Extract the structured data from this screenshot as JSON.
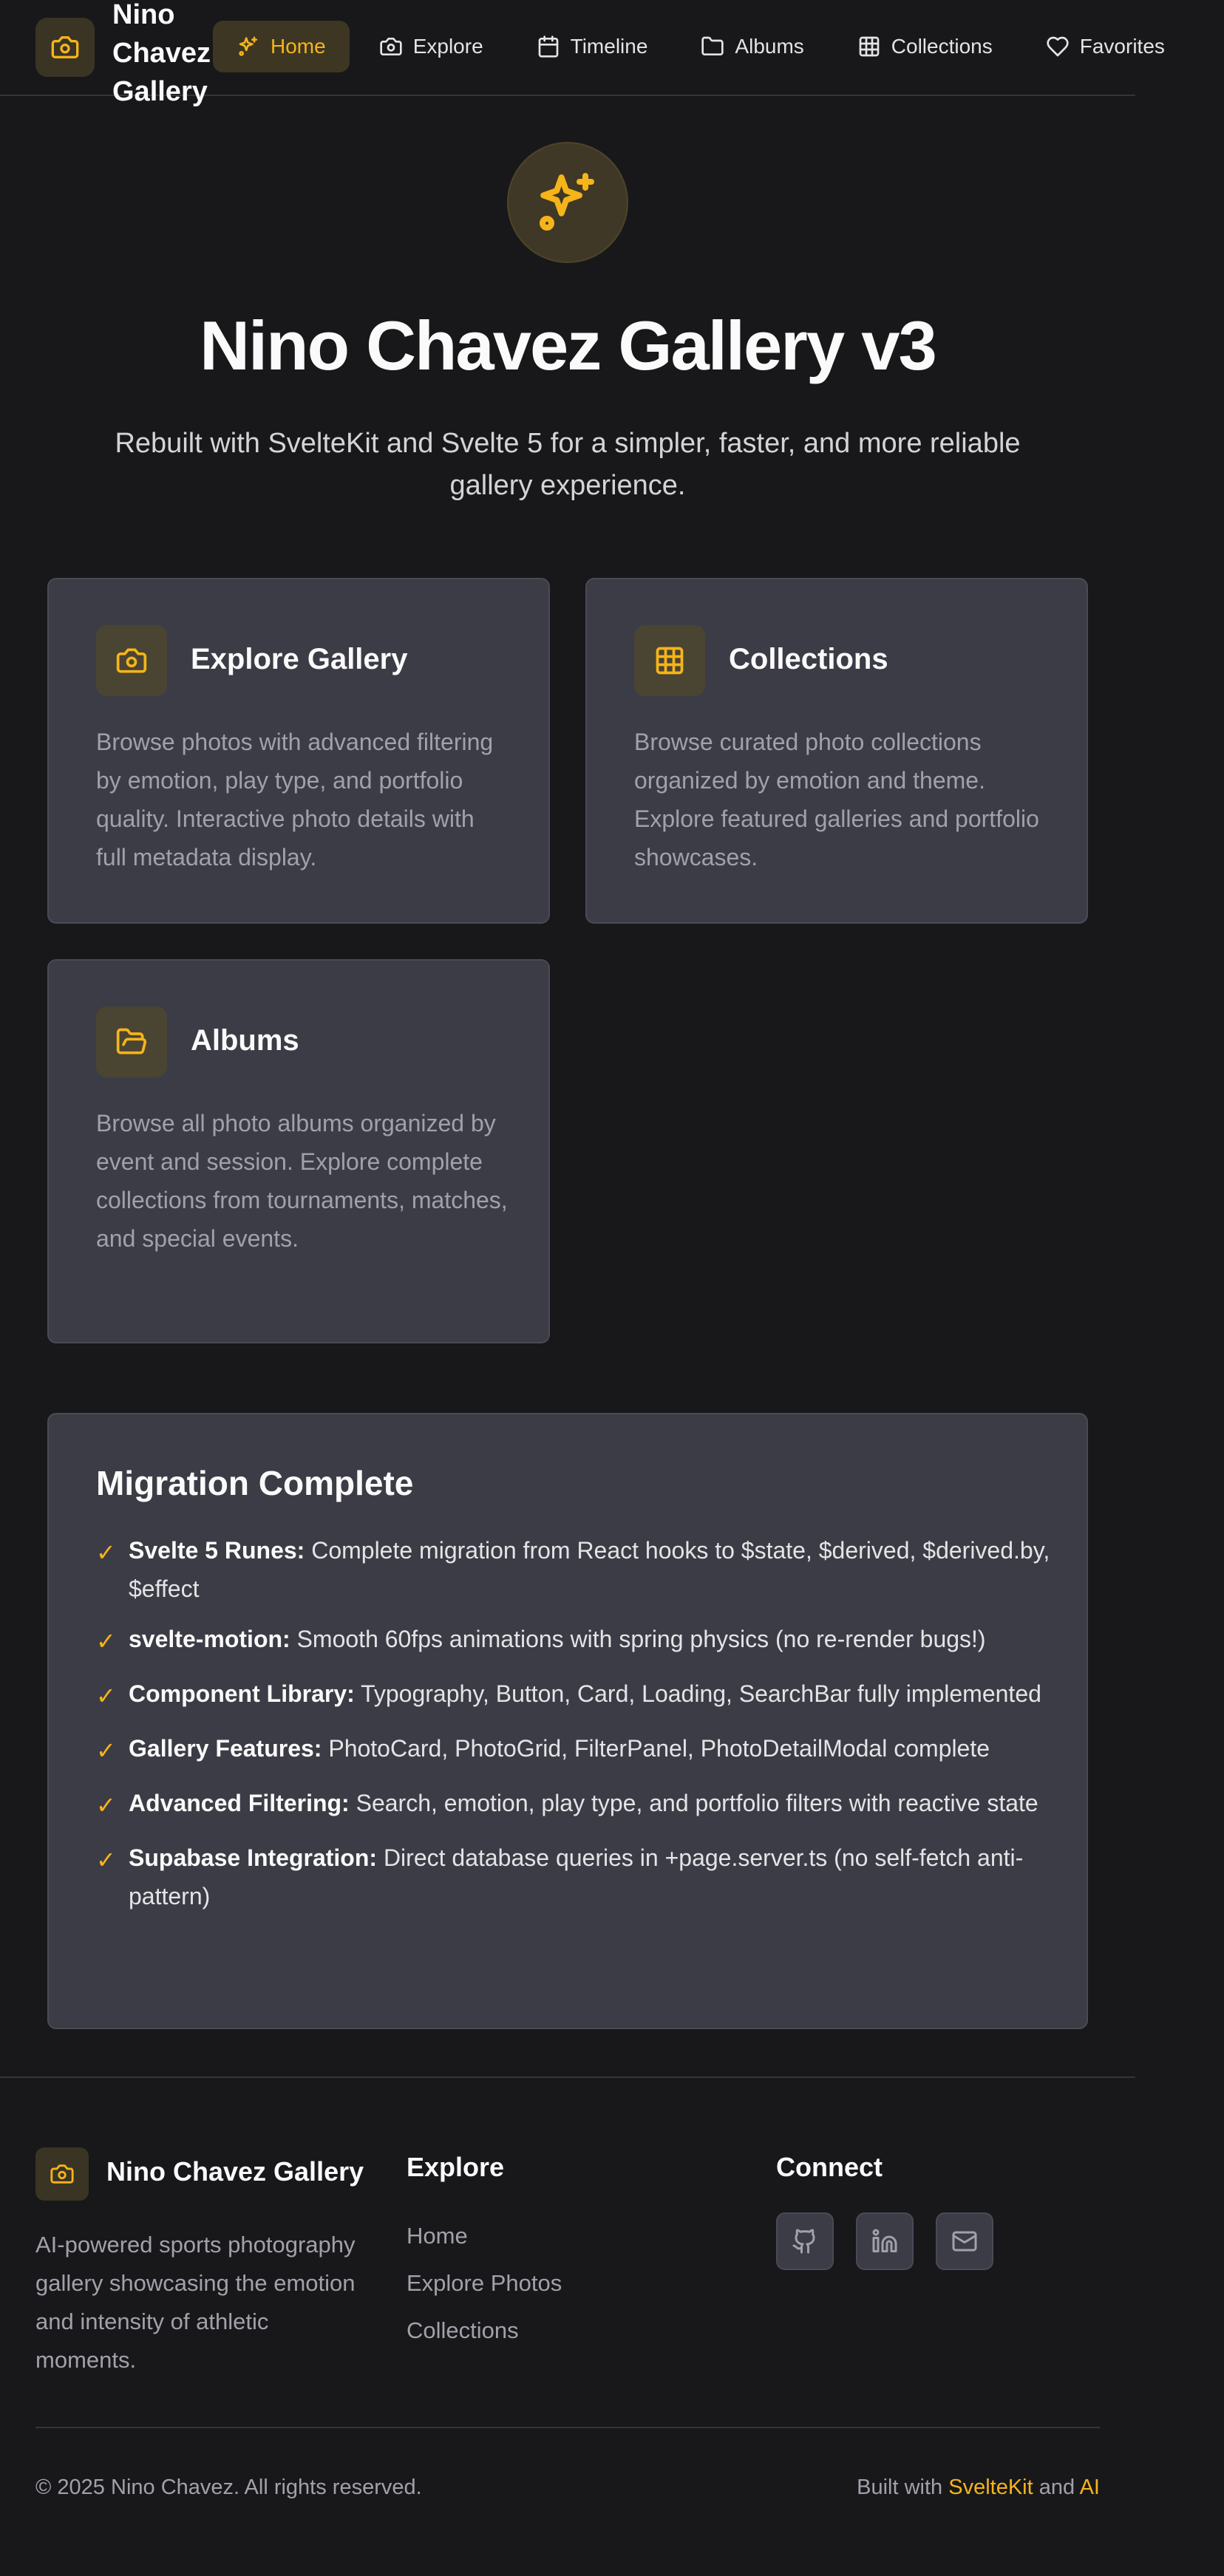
{
  "nav": {
    "brand": "Nino Chavez Gallery",
    "logo_icon": "camera-icon",
    "links": [
      {
        "label": "Home",
        "icon": "sparkles-icon",
        "active": true
      },
      {
        "label": "Explore",
        "icon": "camera-icon"
      },
      {
        "label": "Timeline",
        "icon": "calendar-icon"
      },
      {
        "label": "Albums",
        "icon": "folder-icon"
      },
      {
        "label": "Collections",
        "icon": "grid-icon"
      },
      {
        "label": "Favorites",
        "icon": "heart-icon"
      }
    ]
  },
  "hero": {
    "icon": "sparkles-icon",
    "title": "Nino Chavez Gallery v3",
    "subtitle": "Rebuilt with SvelteKit and Svelte 5 for a simpler, faster, and more reliable gallery experience."
  },
  "features": [
    {
      "title": "Explore Gallery",
      "icon": "camera-icon",
      "description": "Browse photos with advanced filtering by emotion, play type, and portfolio quality. Interactive photo details with full metadata display."
    },
    {
      "title": "Collections",
      "icon": "grid-icon",
      "description": "Browse curated photo collections organized by emotion and theme. Explore featured galleries and portfolio showcases."
    },
    {
      "title": "Albums",
      "icon": "folder-open-icon",
      "description": "Browse all photo albums organized by event and session. Explore complete collections from tournaments, matches, and special events."
    }
  ],
  "migration": {
    "title": "Migration Complete",
    "check_glyph": "✓",
    "items": [
      {
        "label": "Svelte 5 Runes:",
        "text": "Complete migration from React hooks to $state, $derived, $derived.by, $effect"
      },
      {
        "label": "svelte-motion:",
        "text": "Smooth 60fps animations with spring physics (no re-render bugs!)"
      },
      {
        "label": "Component Library:",
        "text": "Typography, Button, Card, Loading, SearchBar fully implemented"
      },
      {
        "label": "Gallery Features:",
        "text": "PhotoCard, PhotoGrid, FilterPanel, PhotoDetailModal complete"
      },
      {
        "label": "Advanced Filtering:",
        "text": "Search, emotion, play type, and portfolio filters with reactive state"
      },
      {
        "label": "Supabase Integration:",
        "text": "Direct database queries in +page.server.ts (no self-fetch anti-pattern)"
      }
    ]
  },
  "footer": {
    "brand": "Nino Chavez Gallery",
    "description": "AI-powered sports photography gallery showcasing the emotion and intensity of athletic moments.",
    "explore_heading": "Explore",
    "explore_links": [
      "Home",
      "Explore Photos",
      "Collections"
    ],
    "connect_heading": "Connect",
    "socials": [
      "github-icon",
      "linkedin-icon",
      "mail-icon"
    ],
    "copyright": "© 2025 Nino Chavez. All rights reserved.",
    "built_prefix": "Built with ",
    "built_tech": "SvelteKit",
    "built_and": " and ",
    "built_ai": "AI"
  },
  "colors": {
    "background": "#18181b",
    "card": "#3c3c46",
    "accent": "#f5b41a",
    "muted_text": "#a1a1aa"
  }
}
